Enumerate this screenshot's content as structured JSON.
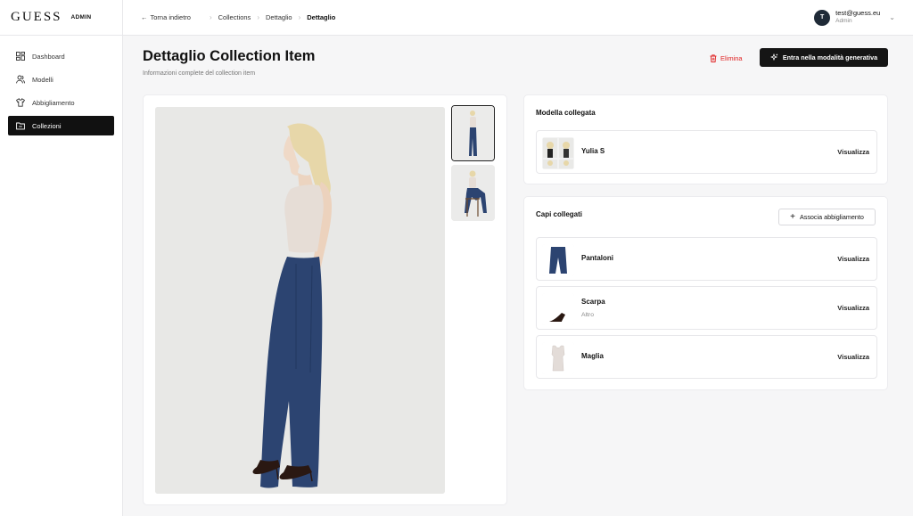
{
  "brand": {
    "logo": "GUESS",
    "badge": "ADMIN"
  },
  "header": {
    "back_label": "Torna indietro",
    "breadcrumbs": [
      "Collections",
      "Dettaglio",
      "Dettaglio"
    ],
    "user": {
      "initial": "T",
      "email": "test@guess.eu",
      "role": "Admin"
    }
  },
  "sidebar": {
    "items": [
      {
        "label": "Dashboard",
        "icon": "dashboard-grid-icon"
      },
      {
        "label": "Modelli",
        "icon": "users-icon"
      },
      {
        "label": "Abbigliamento",
        "icon": "shirt-icon"
      },
      {
        "label": "Collezioni",
        "icon": "folder-icon",
        "active": true
      }
    ]
  },
  "page": {
    "title": "Dettaglio Collection Item",
    "subtitle": "Informazioni complete del collection item",
    "delete_label": "Elimina",
    "generative_label": "Entra nella modalità generativa"
  },
  "model_section": {
    "title": "Modella collegata",
    "model": {
      "name": "Yulia S",
      "action": "Visualizza"
    }
  },
  "garments_section": {
    "title": "Capi collegati",
    "associate_label": "Associa abbigliamento",
    "items": [
      {
        "name": "Pantaloni",
        "category": "",
        "action": "Visualizza"
      },
      {
        "name": "Scarpa",
        "category": "Altro",
        "action": "Visualizza"
      },
      {
        "name": "Maglia",
        "category": "",
        "action": "Visualizza"
      }
    ]
  },
  "colors": {
    "accent": "#151515",
    "danger": "#e02424",
    "denim": "#2b4370"
  }
}
